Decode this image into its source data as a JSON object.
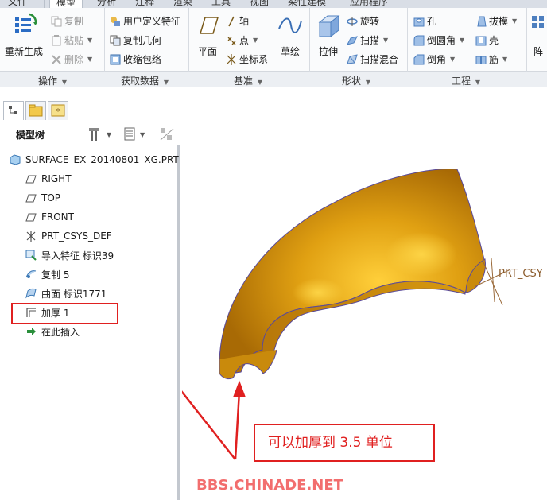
{
  "tabs": [
    "文件",
    "模型",
    "分析",
    "注释",
    "渲染",
    "工具",
    "视图",
    "柔性建模",
    "应用程序"
  ],
  "ribbon": {
    "regen": {
      "label": "重新生成"
    },
    "operations": {
      "copy": "复制",
      "paste": "粘贴",
      "delete": "删除"
    },
    "get_data": {
      "udf": "用户定义特征",
      "copy_geom": "复制几何",
      "shrinkwrap": "收缩包络"
    },
    "datum": {
      "plane": "平面",
      "axis": "轴",
      "point": "点",
      "csys": "坐标系",
      "sketch": "草绘"
    },
    "shapes": {
      "extrude": "拉伸",
      "revolve": "旋转",
      "sweep": "扫描",
      "swept_blend": "扫描混合"
    },
    "engineering": {
      "hole": "孔",
      "round": "倒圆角",
      "chamfer": "倒角",
      "draft": "拔模",
      "shell": "壳",
      "rib": "筋"
    },
    "editing_partial": "阵",
    "groups": {
      "operations": "操作",
      "get_data": "获取数据",
      "datum": "基准",
      "shapes": "形状",
      "engineering": "工程"
    }
  },
  "model_tree": {
    "title": "模型树",
    "nodes": [
      {
        "label": "SURFACE_EX_20140801_XG.PRT",
        "icon": "part-icon"
      },
      {
        "label": "RIGHT",
        "icon": "datum-plane-icon"
      },
      {
        "label": "TOP",
        "icon": "datum-plane-icon"
      },
      {
        "label": "FRONT",
        "icon": "datum-plane-icon"
      },
      {
        "label": "PRT_CSYS_DEF",
        "icon": "csys-icon"
      },
      {
        "label": "导入特征 标识39",
        "icon": "import-feature-icon"
      },
      {
        "label": "复制 5",
        "icon": "copy-feature-icon"
      },
      {
        "label": "曲面 标识1771",
        "icon": "surface-icon"
      },
      {
        "label": "加厚 1",
        "icon": "thicken-icon"
      },
      {
        "label": "在此插入",
        "icon": "insert-here-arrow-icon"
      }
    ]
  },
  "viewport": {
    "csys_label": "PRT_CSY",
    "annotation": "可以加厚到 3.5 单位",
    "watermark": "BBS.CHINADE.NET",
    "colors": {
      "annotation_red": "#e02020",
      "surface_gold": "#d4900a",
      "watermark": "#f26e6e"
    }
  }
}
